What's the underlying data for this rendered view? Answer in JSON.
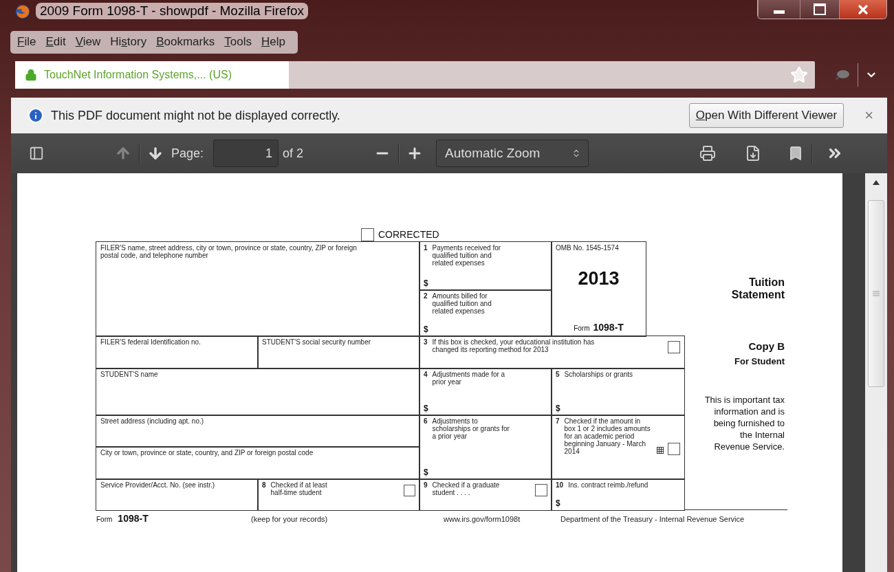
{
  "window": {
    "title": "2009 Form 1098-T - showpdf - Mozilla Firefox"
  },
  "menu": [
    {
      "mnemonic": "F",
      "rest": "ile"
    },
    {
      "mnemonic": "E",
      "rest": "dit"
    },
    {
      "mnemonic": "V",
      "rest": "iew"
    },
    {
      "lead": "Hi",
      "mnemonic": "s",
      "rest": "tory"
    },
    {
      "mnemonic": "B",
      "rest": "ookmarks"
    },
    {
      "mnemonic": "T",
      "rest": "ools"
    },
    {
      "mnemonic": "H",
      "rest": "elp"
    }
  ],
  "identity": {
    "secure": true,
    "label": "TouchNet Information Systems,... (US)"
  },
  "notification": {
    "message": "This PDF document might not be displayed correctly.",
    "button_mnemonic": "O",
    "button_rest": "pen With Different Viewer",
    "close": "×"
  },
  "pdf_toolbar": {
    "previous_disabled": true,
    "next_disabled": false,
    "page_label": "Page:",
    "page_value": "1",
    "page_count": "of 2",
    "zoom": "Automatic Zoom"
  },
  "form": {
    "corrected": {
      "label": "CORRECTED",
      "checked": false
    },
    "filer": "FILER'S name, street address, city or town, province or state, country, ZIP or foreign postal code, and telephone number",
    "box1": {
      "number": "1",
      "label": "Payments received for qualified tuition and related expenses",
      "dollar": "$"
    },
    "box2": {
      "number": "2",
      "label": "Amounts billed for qualified tuition and related expenses",
      "dollar": "$"
    },
    "omb": "OMB No. 1545-1574",
    "year": "2013",
    "form_prefix": "Form",
    "form_number": "1098-T",
    "title_lines": [
      "Tuition",
      "Statement"
    ],
    "filer_id": "FILER'S federal Identification no.",
    "student_ssn": "STUDENT'S social security number",
    "box3": {
      "number": "3",
      "label": "If this box is checked, your educational institution has changed its reporting method for 2013",
      "checked": false
    },
    "copy": "Copy B",
    "copy_for": "For Student",
    "notice": "This is important tax information and is being furnished to the Internal Revenue Service.",
    "student_name": "STUDENT'S name",
    "box4": {
      "number": "4",
      "label": "Adjustments made for a prior year",
      "dollar": "$"
    },
    "box5": {
      "number": "5",
      "label": "Scholarships or grants",
      "dollar": "$"
    },
    "street": "Street address (including apt. no.)",
    "city": "City or town, province or state, country, and ZIP or foreign postal code",
    "box6": {
      "number": "6",
      "label": "Adjustments to scholarships or grants for a prior year",
      "dollar": "$"
    },
    "box7": {
      "number": "7",
      "label": "Checked if the amount in box 1 or 2 includes amounts for an academic period beginning January - March 2014",
      "checked": false
    },
    "service": "Service Provider/Acct. No. (see instr.)",
    "box8": {
      "number": "8",
      "label": "Checked if at least half-time student",
      "checked": false
    },
    "box9": {
      "number": "9",
      "label": "Checked if a graduate student . . . .",
      "checked": false
    },
    "box10": {
      "number": "10",
      "label": "Ins. contract reimb./refund",
      "dollar": "$"
    },
    "footer": {
      "form_prefix": "Form",
      "form_number": "1098-T",
      "keep": "(keep for your records)",
      "url": "www.irs.gov/form1098t",
      "department": "Department of the Treasury - Internal Revenue Service"
    }
  }
}
